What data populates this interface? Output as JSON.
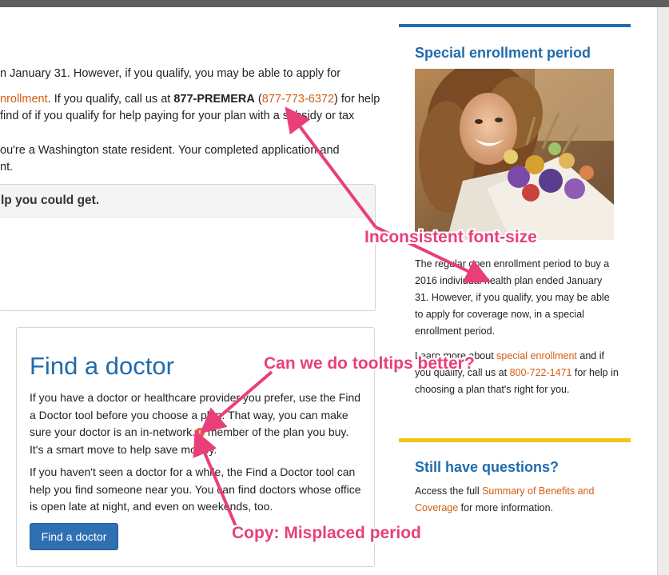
{
  "colors": {
    "accent_blue": "#1f6cad",
    "link_orange": "#d25e14",
    "callout_pink": "#e83f7b",
    "divider_yellow": "#f0c613",
    "button_blue": "#2f70b3"
  },
  "intro": {
    "line1": "n January 31. However, if you qualify, you may be able to apply for",
    "line2_link": "nrollment",
    "line2_a": ". If you qualify, call us at ",
    "line2_phone_bold": "877-PREMERA",
    "line2_b": " (",
    "line2_phone_link": "877-773-6372",
    "line2_c": ") for help",
    "line3": "find of if you qualify for help paying for your plan with a subsidy or tax",
    "line4": "ou're a Washington state resident. Your completed application and",
    "line5": "nt."
  },
  "panel_top": {
    "heading": "lp you could get."
  },
  "doctor_card": {
    "title": "Find a doctor",
    "p1_a": "If you have a doctor or healthcare provider you prefer, use the Find a Doctor tool before you choose a plan. That way, you can make sure your doctor is an in-network.",
    "info_icon": "info-icon",
    "p1_b": " member of the plan you buy. It's a smart move to help save money.",
    "p2": "If you haven't seen a doctor for a while, the Find a Doctor tool can help you find someone near you. You can find doctors whose office is open late at night, and even on weekends, too.",
    "button": "Find a doctor"
  },
  "sidebar": {
    "section1_title": "Special enrollment period",
    "text1": "The regular open enrollment period to buy a 2016 individual health plan ended January 31. However, if you qualify, you may be able to apply for coverage now, in a special enrollment period.",
    "text2_a": "Learn more about ",
    "text2_link": "special enrollment",
    "text2_b": " and if you qualify, call us at ",
    "text2_phone": "800-722-1471",
    "text2_c": " for help in choosing a plan that's right for you.",
    "section2_title": "Still have questions?",
    "text3_a": "Access the full ",
    "text3_link": "Summary of Benefits and Coverage",
    "text3_b": " for more information."
  },
  "annotations": {
    "font_size": "Inconsistent font-size",
    "tooltips": "Can we do tooltips better?",
    "period": "Copy: Misplaced period"
  }
}
